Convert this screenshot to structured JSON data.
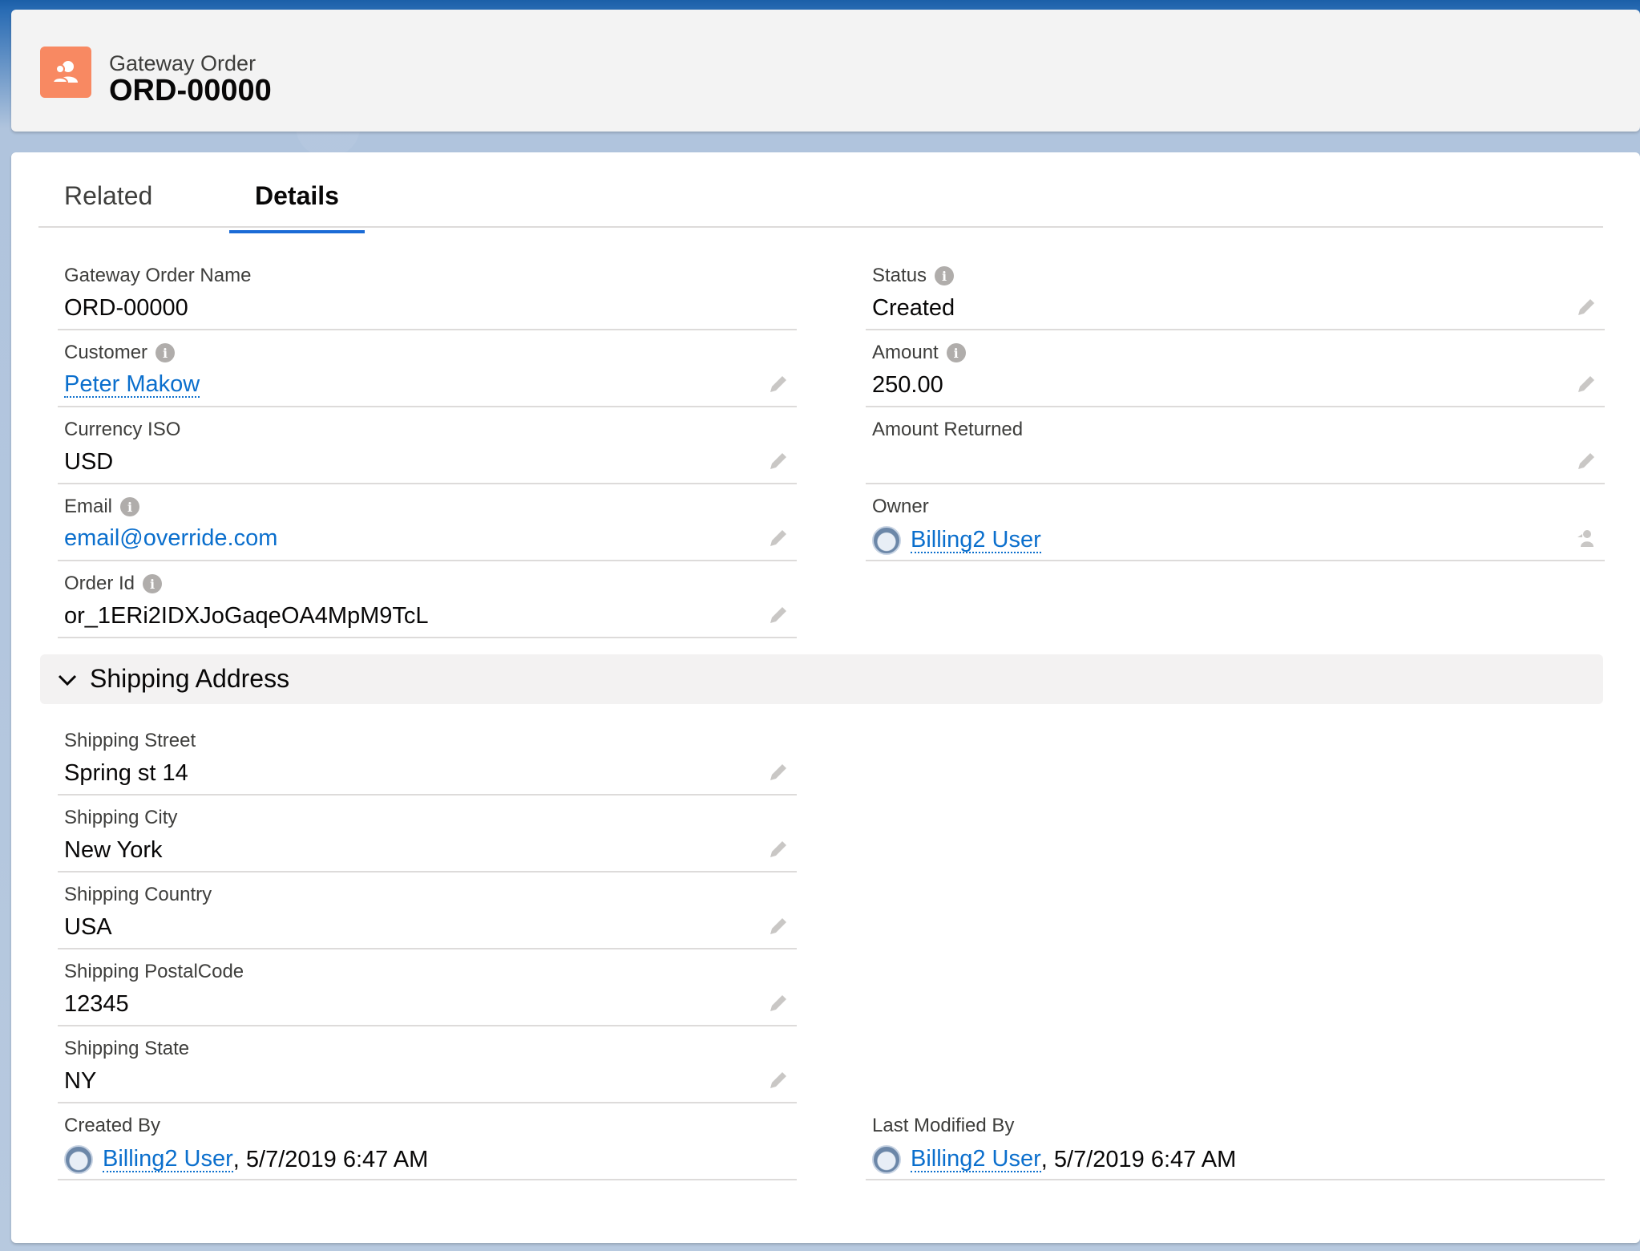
{
  "header": {
    "object_type": "Gateway Order",
    "record_name": "ORD-00000",
    "icon": "user-group-icon",
    "icon_color": "#f88962"
  },
  "tabs": [
    {
      "label": "Related",
      "active": false
    },
    {
      "label": "Details",
      "active": true
    }
  ],
  "fields": {
    "gateway_order_name": {
      "label": "Gateway Order Name",
      "value": "ORD-00000"
    },
    "status": {
      "label": "Status",
      "value": "Created"
    },
    "customer": {
      "label": "Customer",
      "value": "Peter Makow"
    },
    "amount": {
      "label": "Amount",
      "value": "250.00"
    },
    "currency_iso": {
      "label": "Currency ISO",
      "value": "USD"
    },
    "amount_returned": {
      "label": "Amount Returned",
      "value": ""
    },
    "email": {
      "label": "Email",
      "value": "email@override.com"
    },
    "owner": {
      "label": "Owner",
      "value": "Billing2 User"
    },
    "order_id": {
      "label": "Order Id",
      "value": "or_1ERi2IDXJoGaqeOA4MpM9TcL"
    }
  },
  "shipping_section": {
    "title": "Shipping Address",
    "fields": {
      "street": {
        "label": "Shipping Street",
        "value": "Spring st 14"
      },
      "city": {
        "label": "Shipping City",
        "value": "New York"
      },
      "country": {
        "label": "Shipping Country",
        "value": "USA"
      },
      "postal_code": {
        "label": "Shipping PostalCode",
        "value": "12345"
      },
      "state": {
        "label": "Shipping State",
        "value": "NY"
      }
    }
  },
  "system": {
    "created_by": {
      "label": "Created By",
      "user": "Billing2 User",
      "date": ", 5/7/2019 6:47 AM"
    },
    "last_modified_by": {
      "label": "Last Modified By",
      "user": "Billing2 User",
      "date": ", 5/7/2019 6:47 AM"
    }
  },
  "colors": {
    "link": "#0b6fcd",
    "tab_active": "#1b6bd6",
    "border": "#dddbda"
  }
}
